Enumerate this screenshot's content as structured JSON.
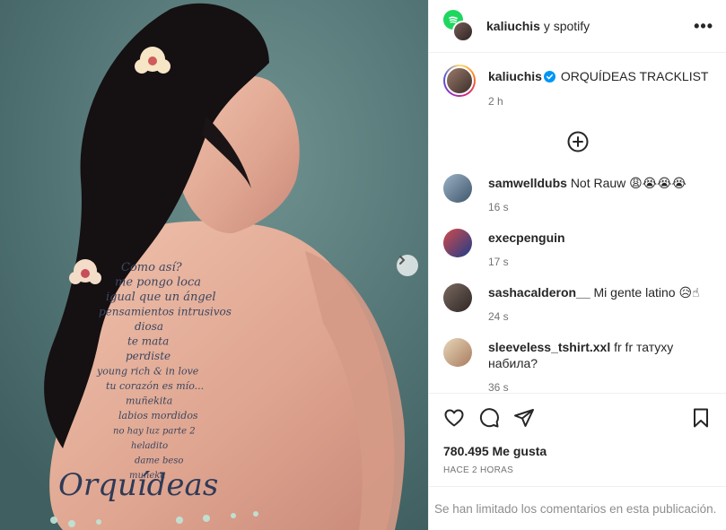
{
  "header": {
    "user": "kaliuchis",
    "collab_text": "y spotify",
    "more_icon": "more-horizontal-icon"
  },
  "caption": {
    "user": "kaliuchis",
    "text": "ORQUÍDEAS TRACKLIST",
    "time": "2 h",
    "verified_color": "#0095f6"
  },
  "comments": [
    {
      "user": "samwelldubs",
      "text": "Not Rauw 😩😭😭😭",
      "time": "16 s"
    },
    {
      "user": "execpenguin",
      "text": "",
      "time": "17 s"
    },
    {
      "user": "sashacalderon__",
      "text": "Mi gente latino 😥☝",
      "time": "24 s"
    },
    {
      "user": "sleeveless_tshirt.xxl",
      "text": "fr fr татуху набила?",
      "time": "36 s"
    }
  ],
  "post": {
    "likes": "780.495 Me gusta",
    "posted": "HACE 2 HORAS"
  },
  "footer": {
    "limited": "Se han limitado los comentarios en esta publicación."
  },
  "tattoo_lines": [
    "Como así?",
    "me pongo loca",
    "igual que un ángel",
    "pensamientos intrusivos",
    "diosa",
    "te mata",
    "perdiste",
    "young rich & in love",
    "tu corazón es mío...",
    "muñekita",
    "labios mordidos",
    "no hay luz parte 2",
    "heladito",
    "dame beso",
    "muñeka"
  ],
  "tattoo_title": "Orquídeas"
}
